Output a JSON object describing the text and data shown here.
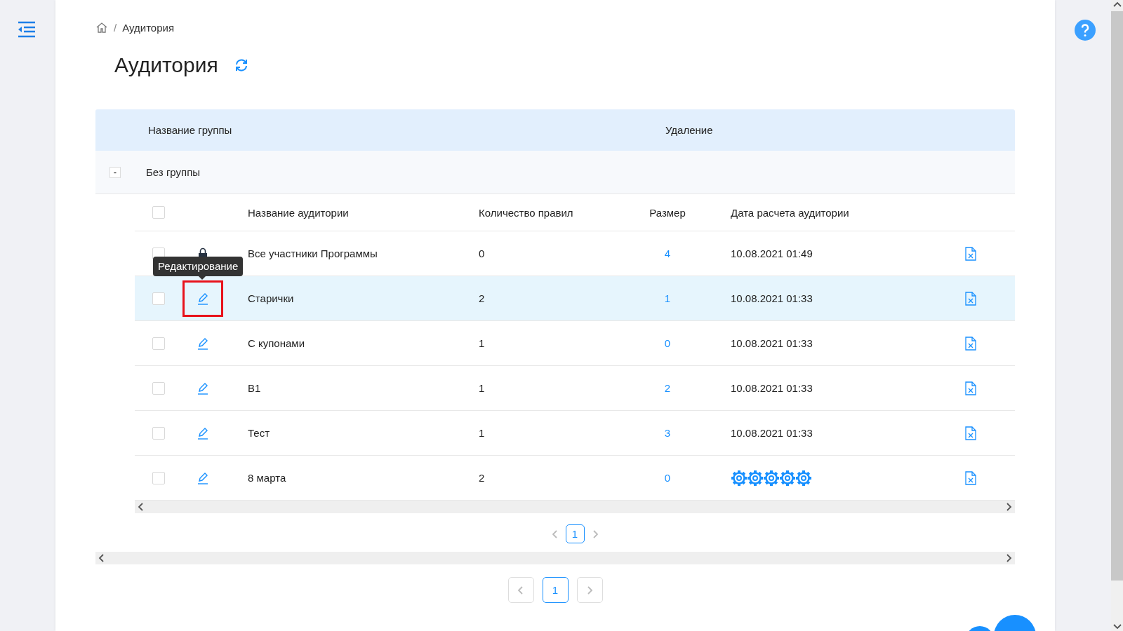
{
  "breadcrumb": {
    "separator": "/",
    "current": "Аудитория"
  },
  "title": "Аудитория",
  "groups_table": {
    "columns": [
      "Название группы",
      "Удаление"
    ],
    "groups": [
      {
        "name": "Без группы",
        "toggle": "-",
        "expanded": true,
        "audiences": {
          "all_checked": false,
          "columns": [
            "Название аудитории",
            "Количество правил",
            "Размер",
            "Дата расчета аудитории"
          ],
          "rows": [
            {
              "kind": "locked",
              "checked": false,
              "name": "Все участники Программы",
              "rules": "0",
              "size": "4",
              "date": "10.08.2021 01:49",
              "calculating": false,
              "selected": false,
              "annotated": false
            },
            {
              "kind": "editable",
              "checked": false,
              "name": "Старички",
              "rules": "2",
              "size": "1",
              "date": "10.08.2021 01:33",
              "calculating": false,
              "selected": true,
              "annotated": true,
              "tooltip": "Редактирование"
            },
            {
              "kind": "editable",
              "checked": false,
              "name": "С купонами",
              "rules": "1",
              "size": "0",
              "date": "10.08.2021 01:33",
              "calculating": false,
              "selected": false,
              "annotated": false
            },
            {
              "kind": "editable",
              "checked": false,
              "name": "B1",
              "rules": "1",
              "size": "2",
              "date": "10.08.2021 01:33",
              "calculating": false,
              "selected": false,
              "annotated": false
            },
            {
              "kind": "editable",
              "checked": false,
              "name": "Тест",
              "rules": "1",
              "size": "3",
              "date": "10.08.2021 01:33",
              "calculating": false,
              "selected": false,
              "annotated": false
            },
            {
              "kind": "editable",
              "checked": false,
              "name": "8 марта",
              "rules": "2",
              "size": "0",
              "calculating": true,
              "selected": false,
              "annotated": false
            }
          ],
          "pagination": {
            "pages": [
              {
                "label": "1",
                "selected": true
              }
            ]
          }
        }
      }
    ]
  },
  "pagination": {
    "pages": [
      {
        "label": "1",
        "selected": true
      }
    ]
  }
}
